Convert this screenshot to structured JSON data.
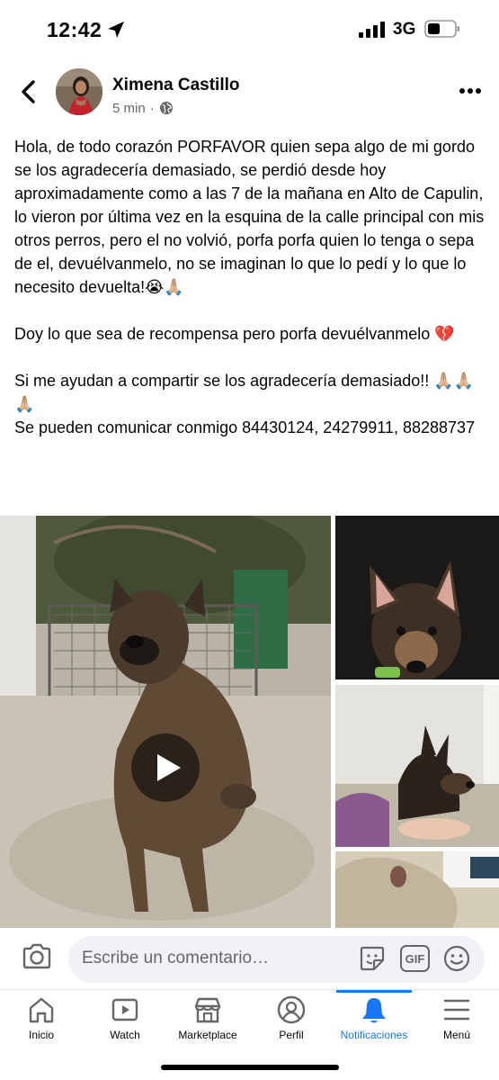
{
  "status_bar": {
    "time": "12:42",
    "network": "3G",
    "icons": [
      "location-arrow-icon",
      "signal-bars-icon",
      "battery-icon"
    ]
  },
  "post": {
    "author": "Ximena Castillo",
    "time": "5 min",
    "separator": "·",
    "privacy_icon": "globe-icon",
    "paragraphs": [
      "Hola, de todo corazón PORFAVOR quien sepa algo de mi gordo se los agradecería demasiado, se perdió desde hoy aproximadamente como a las 7 de la mañana en Alto de Capulin, lo vieron por última vez en la esquina de la calle principal con mis otros perros, pero el no volvió, porfa porfa quien lo tenga o sepa de el, devuélvanmelo, no se imaginan lo que lo pedí y lo que lo necesito devuelta!😭🙏🏼",
      "Doy lo que sea de recompensa pero porfa devuélvanmelo 💔",
      "Si me ayudan a compartir se los agradecería demasiado!! 🙏🏼🙏🏼🙏🏼",
      "Se pueden comunicar conmigo 84430124, 24279911, 88288737"
    ]
  },
  "media": {
    "items": [
      "dog-video-thumbnail",
      "dog-photo-ears",
      "dog-photo-couch",
      "dog-photo-partial"
    ],
    "play_icon": "play-icon"
  },
  "comment_bar": {
    "placeholder": "Escribe un comentario…",
    "icons": [
      "camera-icon",
      "sticker-icon",
      "gif-icon",
      "emoji-icon"
    ],
    "gif_label": "GIF"
  },
  "bottom_nav": {
    "items": [
      {
        "label": "Inicio",
        "icon": "home-icon"
      },
      {
        "label": "Watch",
        "icon": "watch-icon"
      },
      {
        "label": "Marketplace",
        "icon": "marketplace-icon"
      },
      {
        "label": "Perfil",
        "icon": "profile-icon"
      },
      {
        "label": "Notificaciones",
        "icon": "bell-icon"
      },
      {
        "label": "Menú",
        "icon": "menu-icon"
      }
    ],
    "active_index": 4
  },
  "colors": {
    "accent": "#1877f2",
    "text": "#050505",
    "secondary_text": "#65676b",
    "input_bg": "#f0f2f5"
  }
}
